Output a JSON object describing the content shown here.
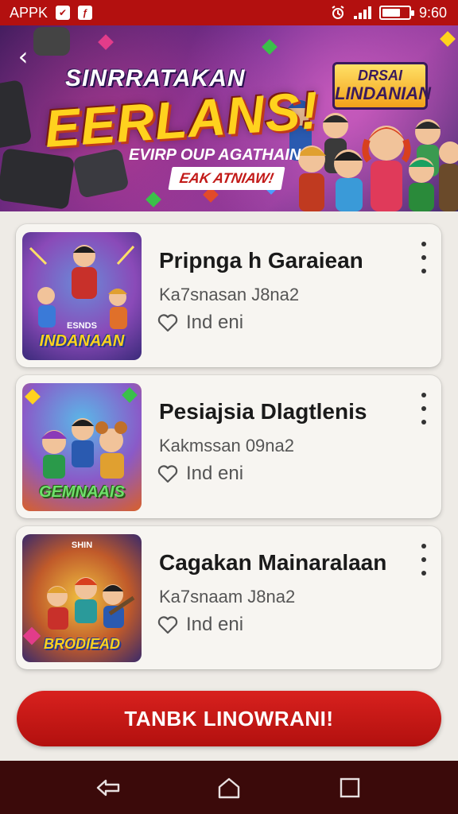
{
  "status_bar": {
    "app_label": "APPK",
    "time": "9:60",
    "icons": [
      "app-notification-icon",
      "app-notification-icon-2",
      "alarm-icon",
      "signal-icon",
      "battery-icon"
    ],
    "battery_level": 0.7
  },
  "banner": {
    "line1": "SINRRATAKAN",
    "headline": "EERLANS!",
    "subline": "EVIRP OUP AGATHAIN",
    "tag": "EAK ATNIAW!",
    "logo_line1": "DRSAI",
    "logo_line2": "LINDANIAN"
  },
  "games": [
    {
      "title": "Pripnga h Garaiean",
      "subtitle": "Ka7snasan J8na2",
      "fav_label": "Ind eni",
      "thumb_label": "ESNDS",
      "thumb_title": "INDANAAN"
    },
    {
      "title": "Pesiajsia Dlagtlenis",
      "subtitle": "Kakmssan 09na2",
      "fav_label": "Ind eni",
      "thumb_label": "",
      "thumb_title": "GEMNAAIS"
    },
    {
      "title": "Cagakan Mainaralaan",
      "subtitle": "Ka7snaam J8na2",
      "fav_label": "Ind eni",
      "thumb_label": "SHIN",
      "thumb_title": "BRODIEAD"
    }
  ],
  "cta": {
    "label": "TANBK LINOWRANI!"
  },
  "colors": {
    "brand_red": "#b3100f",
    "nav_bar": "#3b0a0a"
  }
}
